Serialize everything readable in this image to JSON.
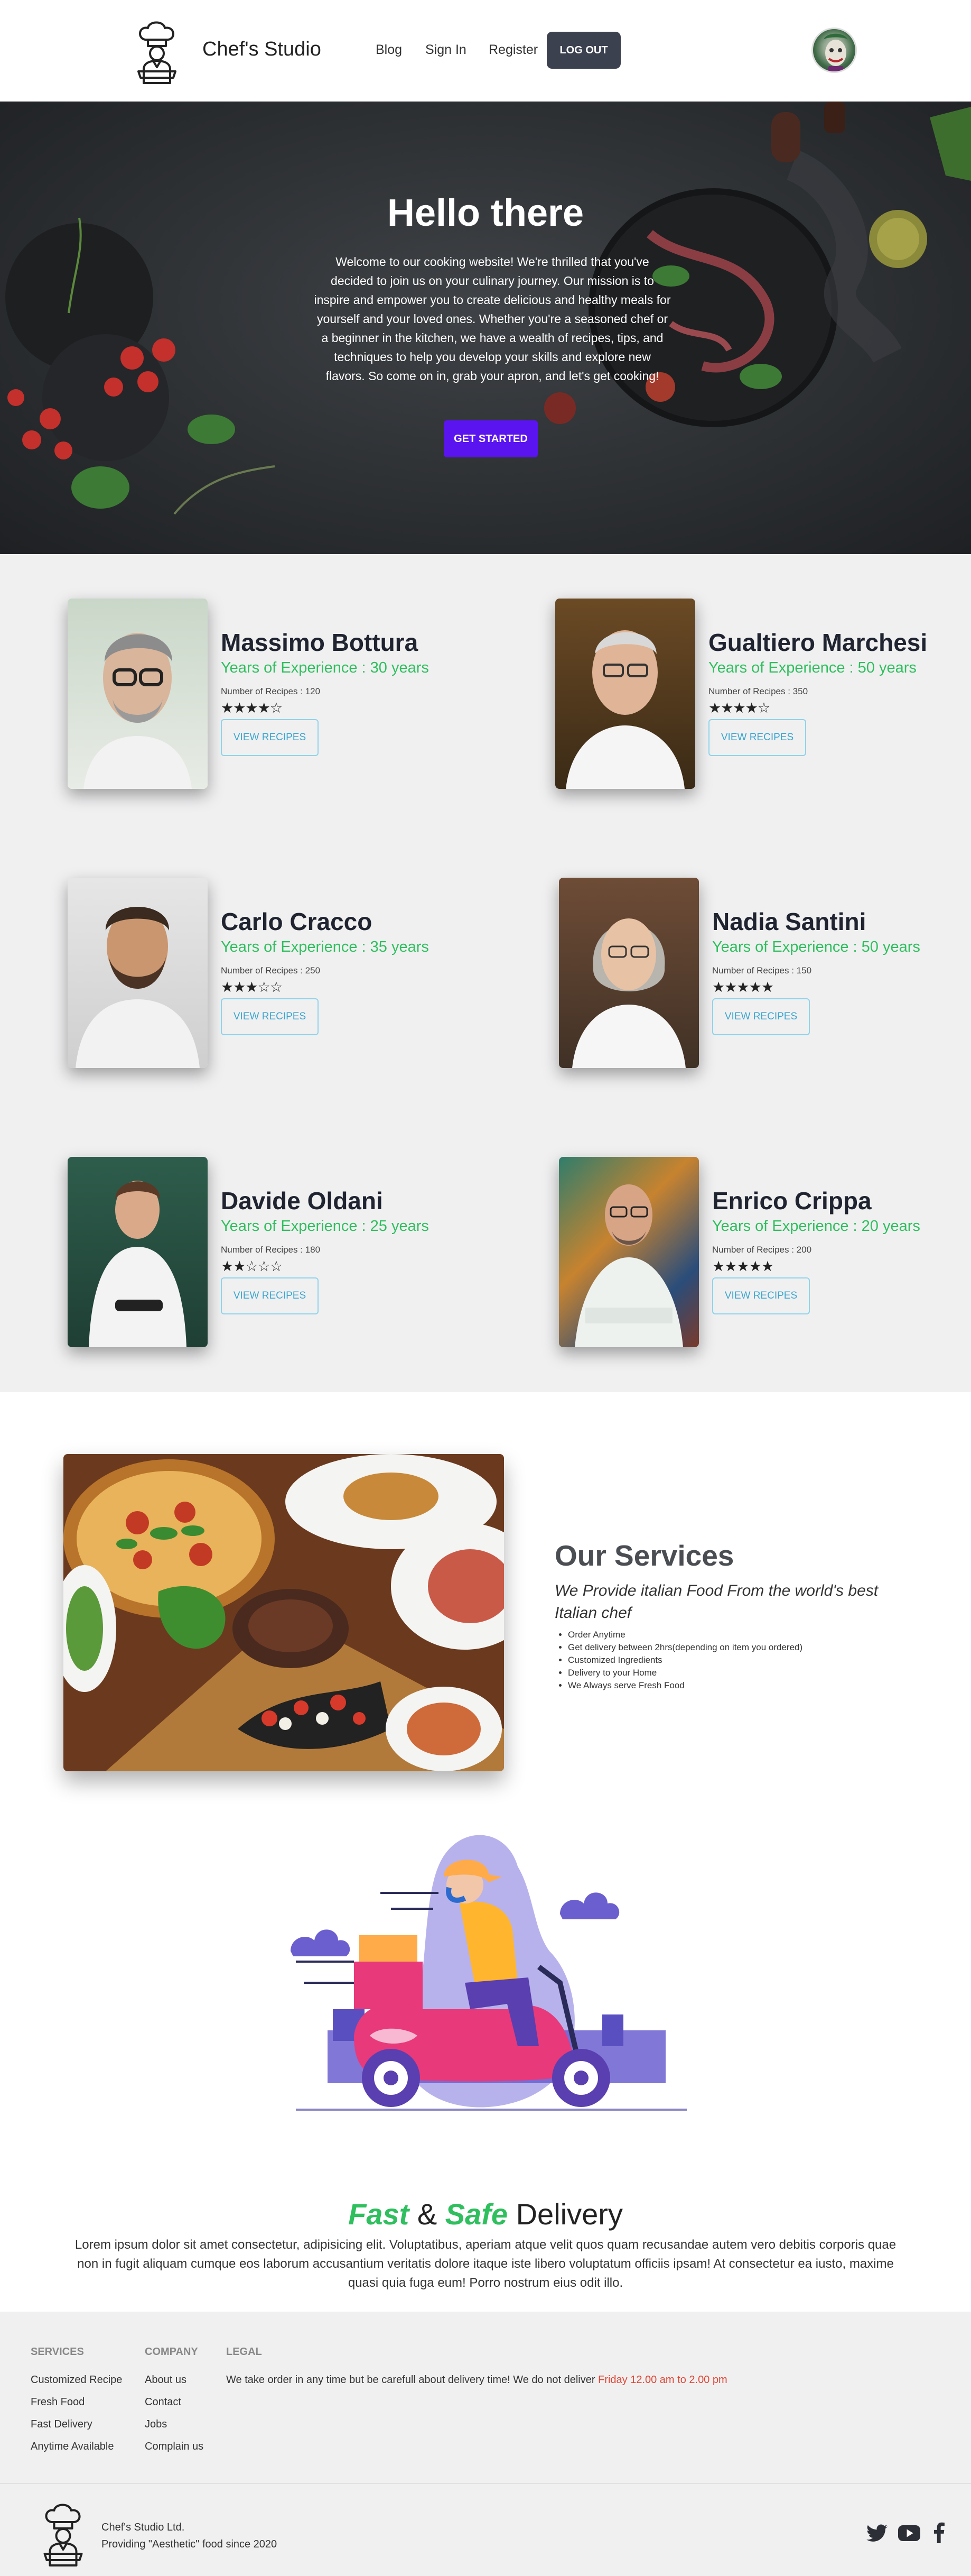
{
  "nav": {
    "brand": "Chef's Studio",
    "links": [
      "Blog",
      "Sign In",
      "Register"
    ],
    "logout": "LOG OUT"
  },
  "hero": {
    "title": "Hello there",
    "text": "Welcome to our cooking website! We're thrilled that you've decided to join us on your culinary journey. Our mission is to inspire and empower you to create delicious and healthy meals for yourself and your loved ones. Whether you're a seasoned chef or a beginner in the kitchen, we have a wealth of recipes, tips, and techniques to help you develop your skills and explore new flavors. So come on in, grab your apron, and let's get cooking!",
    "button": "GET STARTED"
  },
  "chefs": [
    {
      "name": "Massimo Bottura",
      "experience": "Years of Experience : 30 years",
      "recipes": "Number of Recipes : 120",
      "rating": 4,
      "button": "VIEW RECIPES"
    },
    {
      "name": "Gualtiero Marchesi",
      "experience": "Years of Experience : 50 years",
      "recipes": "Number of Recipes : 350",
      "rating": 4,
      "button": "VIEW RECIPES"
    },
    {
      "name": "Carlo Cracco",
      "experience": "Years of Experience : 35 years",
      "recipes": "Number of Recipes : 250",
      "rating": 3,
      "button": "VIEW RECIPES"
    },
    {
      "name": "Nadia Santini",
      "experience": "Years of Experience : 50 years",
      "recipes": "Number of Recipes : 150",
      "rating": 5,
      "button": "VIEW RECIPES"
    },
    {
      "name": "Davide Oldani",
      "experience": "Years of Experience : 25 years",
      "recipes": "Number of Recipes : 180",
      "rating": 2,
      "button": "VIEW RECIPES"
    },
    {
      "name": "Enrico Crippa",
      "experience": "Years of Experience : 20 years",
      "recipes": "Number of Recipes : 200",
      "rating": 5,
      "button": "VIEW RECIPES"
    }
  ],
  "services": {
    "title": "Our Services",
    "subtitle": "We Provide italian Food From the world's best Italian chef",
    "items": [
      "Order Anytime",
      "Get delivery between 2hrs(depending on item you ordered)",
      "Customized Ingredients",
      "Delivery to your Home",
      "We Always serve Fresh Food"
    ]
  },
  "delivery": {
    "fast": "Fast",
    "amp": "&",
    "safe": "Safe",
    "word": "Delivery",
    "text": "Lorem ipsum dolor sit amet consectetur, adipisicing elit. Voluptatibus, aperiam atque velit quos quam recusandae autem vero debitis corporis quae non in fugit aliquam cumque eos laborum accusantium veritatis dolore itaque iste libero voluptatum officiis ipsam! At consectetur ea iusto, maxime quasi quia fuga eum! Porro nostrum eius odit illo."
  },
  "footer": {
    "services_head": "SERVICES",
    "services": [
      "Customized Recipe",
      "Fresh Food",
      "Fast Delivery",
      "Anytime Available"
    ],
    "company_head": "COMPANY",
    "company": [
      "About us",
      "Contact",
      "Jobs",
      "Complain us"
    ],
    "legal_head": "LEGAL",
    "legal_text": "We take order in any time but be carefull about delivery time! We do not deliver",
    "legal_hours": "Friday 12.00 am to 2.00 pm",
    "company_name": "Chef's Studio Ltd.",
    "tagline": "Providing \"Aesthetic\" food since 2020"
  },
  "colors": {
    "accent": "#5a14f0",
    "green": "#2fbf5e",
    "cyan": "#3aa5cf",
    "red": "#e04432"
  }
}
